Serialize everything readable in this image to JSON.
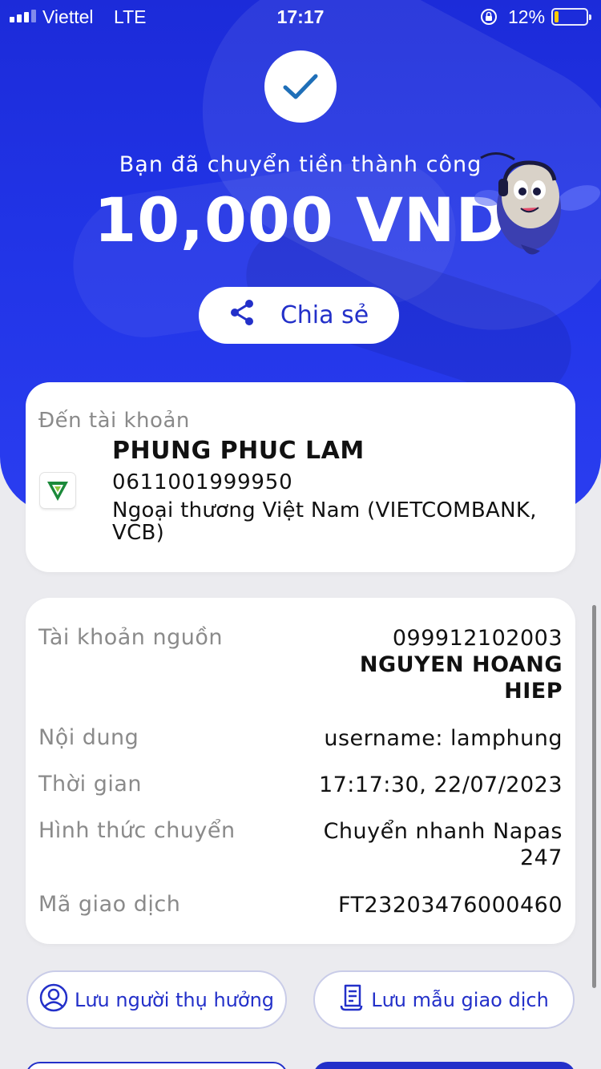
{
  "status_bar": {
    "carrier": "Viettel",
    "network": "LTE",
    "time": "17:17",
    "battery_percent": "12%",
    "battery_level": 0.12,
    "icons": [
      "signal-icon",
      "orientation-lock-icon",
      "battery-icon"
    ]
  },
  "result": {
    "message": "Bạn đã chuyển tiền thành công",
    "amount": "10,000 VND",
    "share_label": "Chia sẻ"
  },
  "destination": {
    "label": "Đến tài khoản",
    "name": "PHUNG PHUC LAM",
    "account_number": "0611001999950",
    "bank": "Ngoại thương Việt Nam (VIETCOMBANK, VCB)"
  },
  "details": {
    "source_label": "Tài khoản nguồn",
    "source_account": "099912102003",
    "source_name": "NGUYEN HOANG HIEP",
    "content_label": "Nội dung",
    "content_value": "username: lamphung",
    "time_label": "Thời gian",
    "time_value": "17:17:30, 22/07/2023",
    "method_label": "Hình thức chuyển",
    "method_value": "Chuyển nhanh Napas 247",
    "txn_label": "Mã giao dịch",
    "txn_value": "FT23203476000460"
  },
  "actions": {
    "save_recipient": "Lưu người thụ hưởng",
    "save_template": "Lưu mẫu giao dịch"
  },
  "colors": {
    "primary": "#2330c9",
    "hero_blue": "#2134e6",
    "success_check": "#1f6fb8",
    "vietcombank_green": "#1b8a3a",
    "battery_low": "#ffcc00"
  }
}
